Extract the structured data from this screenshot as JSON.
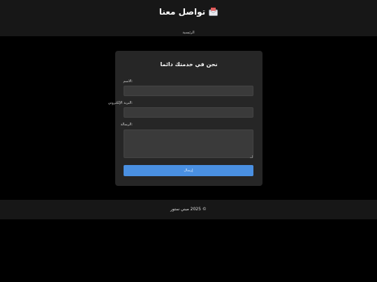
{
  "header": {
    "title": "تواصل معنا",
    "icon": "mailbox-icon",
    "nav": [
      {
        "label": "الرئيسية"
      }
    ]
  },
  "form": {
    "heading": "نحن في خدمتك دائما",
    "fields": {
      "name": {
        "label": ":الاسم",
        "value": ""
      },
      "email": {
        "label": ":البريد الإلكتروني",
        "value": ""
      },
      "message": {
        "label": ":الرسالة",
        "value": ""
      }
    },
    "submit_label": "إرسال"
  },
  "footer": {
    "copyright_symbol": "©",
    "year": "2025",
    "text": "مبني ستور"
  },
  "colors": {
    "background": "#000000",
    "header_bg": "#171717",
    "card_bg": "#262626",
    "input_bg": "#3a3a3a",
    "accent": "#4a90e2"
  }
}
